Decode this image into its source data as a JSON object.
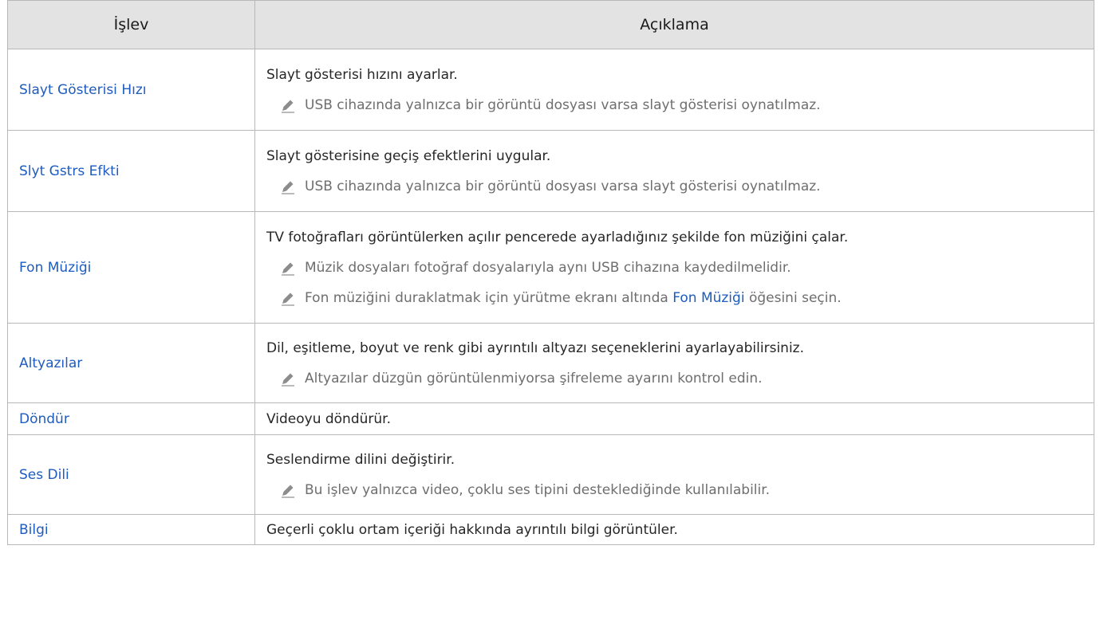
{
  "header": {
    "col1": "İşlev",
    "col2": "Açıklama"
  },
  "rows": [
    {
      "name": "Slayt Gösterisi Hızı",
      "desc": "Slayt gösterisi hızını ayarlar.",
      "notes": [
        "USB cihazında yalnızca bir görüntü dosyası varsa slayt gösterisi oynatılmaz."
      ]
    },
    {
      "name": "Slyt Gstrs Efkti",
      "desc": "Slayt gösterisine geçiş efektlerini uygular.",
      "notes": [
        "USB cihazında yalnızca bir görüntü dosyası varsa slayt gösterisi oynatılmaz."
      ]
    },
    {
      "name": "Fon Müziği",
      "desc": "TV fotoğrafları görüntülerken açılır pencerede ayarladığınız şekilde fon müziğini çalar.",
      "notes": [
        "Müzik dosyaları fotoğraf dosyalarıyla aynı USB cihazına kaydedilmelidir.",
        {
          "before": "Fon müziğini duraklatmak için yürütme ekranı altında ",
          "link": "Fon Müziği",
          "after": " öğesini seçin."
        }
      ]
    },
    {
      "name": "Altyazılar",
      "desc": "Dil, eşitleme, boyut ve renk gibi ayrıntılı altyazı seçeneklerini ayarlayabilirsiniz.",
      "notes": [
        "Altyazılar düzgün görüntülenmiyorsa şifreleme ayarını kontrol edin."
      ]
    },
    {
      "name": "Döndür",
      "desc": "Videoyu döndürür.",
      "notes": []
    },
    {
      "name": "Ses Dili",
      "desc": "Seslendirme dilini değiştirir.",
      "notes": [
        "Bu işlev yalnızca video, çoklu ses tipini desteklediğinde kullanılabilir."
      ]
    },
    {
      "name": "Bilgi",
      "desc": "Geçerli çoklu ortam içeriği hakkında ayrıntılı bilgi görüntüler.",
      "notes": []
    }
  ],
  "icons": {
    "note": "pencil-note-icon"
  },
  "colors": {
    "link": "#1e5bbf",
    "header_bg": "#e3e3e3",
    "note_text": "#6e6e6e"
  }
}
